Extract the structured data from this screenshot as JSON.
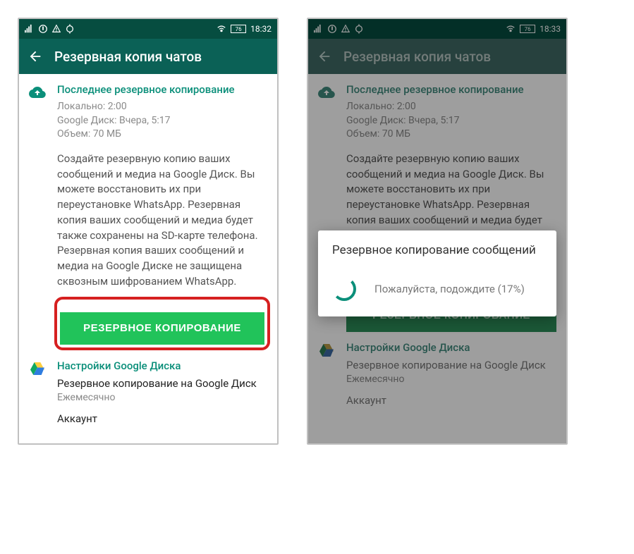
{
  "left": {
    "status": {
      "time": "18:32",
      "battery": "76"
    },
    "appbar": {
      "title": "Резервная копия чатов"
    },
    "lastBackup": {
      "heading": "Последнее резервное копирование",
      "local": "Локально: 2:00",
      "gdrive": "Google Диск: Вчера, 5:17",
      "size": "Объем: 70 МБ"
    },
    "description": "Создайте резервную копию ваших сообщений и медиа на Google Диск. Вы можете восстановить их при переустановке WhatsApp. Резервная копия ваших сообщений и медиа будет также сохранены на SD-карте телефона. Резервная копия ваших сообщений и медиа на Google Диске не защищена сквозным шифрованием WhatsApp.",
    "backupBtn": "РЕЗЕРВНОЕ КОПИРОВАНИЕ",
    "gdriveSettings": {
      "heading": "Настройки Google Диска",
      "line1": "Резервное копирование на Google Диск",
      "line2": "Ежемесячно",
      "account": "Аккаунт"
    }
  },
  "right": {
    "status": {
      "time": "18:33",
      "battery": "76"
    },
    "appbar": {
      "title": "Резервная копия чатов"
    },
    "lastBackup": {
      "heading": "Последнее резервное копирование",
      "local": "Локально: 2:00",
      "gdrive": "Google Диск: Вчера, 5:17",
      "size": "Объем: 70 МБ"
    },
    "description": "Создайте резервную копию ваших сообщений и медиа на Google Диск. Вы можете восстановить их при переустановке WhatsApp. Резервная копия ваших сообщений и медиа будет также сохранены на SD-карте телефона. Резервная копия ваших сообщений и медиа на Google Диске не защищена сквозным шифрованием WhatsApp.",
    "backupBtn": "РЕЗЕРВНОЕ КОПИРОВАНИЕ",
    "gdriveSettings": {
      "heading": "Настройки Google Диска",
      "line1": "Резервное копирование на Google Диск",
      "line2": "Ежемесячно",
      "account": "Аккаунт"
    },
    "dialog": {
      "title": "Резервное копирование сообщений",
      "wait": "Пожалуйста, подождите (17%)"
    }
  }
}
